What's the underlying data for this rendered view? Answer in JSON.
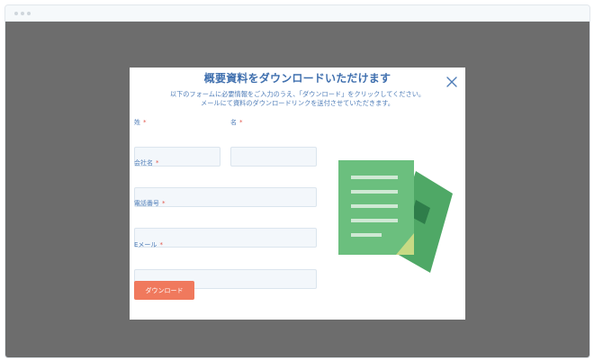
{
  "colors": {
    "title": "#3f6fae",
    "label": "#4f7db8",
    "required": "#e2574c",
    "button": "#f0795d",
    "overlay": "#6d6d6d",
    "doc_back": "#4fa866",
    "doc_front": "#6bbf7e",
    "doc_lines": "#cfe9d4"
  },
  "modal": {
    "title": "概要資料をダウンロードいただけます",
    "description_line1": "以下のフォームに必要情報をご入力のうえ、「ダウンロード」をクリックしてください。",
    "description_line2": "メールにて資料のダウンロードリンクを送付させていただきます。",
    "close_icon": "close-icon",
    "illustration_icon": "document-icon"
  },
  "form": {
    "required_mark": "*",
    "last_name": {
      "label": "姓",
      "value": "",
      "placeholder": ""
    },
    "first_name": {
      "label": "名",
      "value": "",
      "placeholder": ""
    },
    "company": {
      "label": "会社名",
      "value": "",
      "placeholder": ""
    },
    "phone": {
      "label": "電話番号",
      "value": "",
      "placeholder": ""
    },
    "email": {
      "label": "Eメール",
      "value": "",
      "placeholder": ""
    },
    "submit_label": "ダウンロード"
  }
}
